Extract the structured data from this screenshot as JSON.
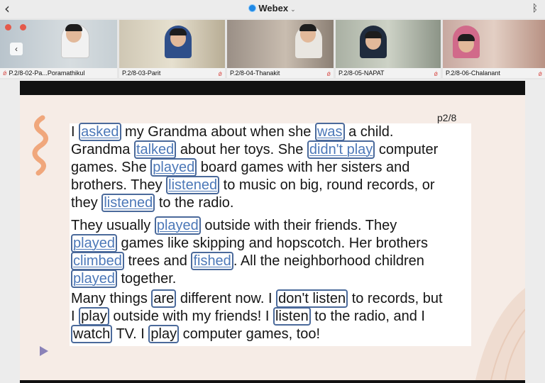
{
  "app": {
    "title": "Webex",
    "back_icon": "chevron-left-icon",
    "status_icon": "bluetooth-icon"
  },
  "participants": [
    {
      "name": "P.2/8-02-Pa...Poramathikul",
      "muted": true
    },
    {
      "name": "P.2/8-03-Parit",
      "muted": true
    },
    {
      "name": "P.2/8-04-Thanakit",
      "muted": true
    },
    {
      "name": "P.2/8-05-NAPAT",
      "muted": true
    },
    {
      "name": "P.2/8-06-Chalanant",
      "muted": true
    }
  ],
  "slide": {
    "page": "p2/8",
    "paragraphs": [
      [
        [
          {
            "t": "I "
          },
          {
            "v": "asked",
            "u": true
          },
          {
            "t": " my Grandma about when she "
          },
          {
            "v": "was",
            "u": true
          },
          {
            "t": " a child."
          }
        ],
        [
          {
            "t": "Grandma "
          },
          {
            "v": "talked",
            "u": true
          },
          {
            "t": " about her toys. She "
          },
          {
            "v": "didn't play",
            "u": true
          },
          {
            "t": " computer"
          }
        ],
        [
          {
            "t": "games. She "
          },
          {
            "v": "played",
            "u": true
          },
          {
            "t": " board games with her sisters and"
          }
        ],
        [
          {
            "t": "brothers. They "
          },
          {
            "v": "listened",
            "u": true
          },
          {
            "t": " to music on big, round records, or"
          }
        ],
        [
          {
            "t": "they "
          },
          {
            "v": "listened",
            "u": true
          },
          {
            "t": " to the radio."
          }
        ]
      ],
      [
        [
          {
            "t": "They usually "
          },
          {
            "v": "played",
            "u": true
          },
          {
            "t": " outside with their friends. They"
          }
        ],
        [
          {
            "v": "played",
            "u": true
          },
          {
            "t": " games like skipping and hopscotch. Her brothers"
          }
        ],
        [
          {
            "v": "climbed",
            "u": true
          },
          {
            "t": " trees and "
          },
          {
            "v": "fished",
            "u": true
          },
          {
            "t": ". All the neighborhood children"
          }
        ],
        [
          {
            "v": "played",
            "u": true
          },
          {
            "t": " together."
          }
        ]
      ],
      [
        [
          {
            "t": "Many things "
          },
          {
            "v": "are",
            "u": false
          },
          {
            "t": " different now. I "
          },
          {
            "v": "don't listen",
            "u": false
          },
          {
            "t": " to records, but"
          }
        ],
        [
          {
            "t": "I "
          },
          {
            "v": "play",
            "u": false
          },
          {
            "t": " outside with my friends! I "
          },
          {
            "v": "listen",
            "u": false
          },
          {
            "t": " to the radio, and I"
          }
        ],
        [
          {
            "v": "watch",
            "u": false
          },
          {
            "t": " TV. I "
          },
          {
            "v": "play",
            "u": false
          },
          {
            "t": " computer games, too!"
          }
        ]
      ]
    ]
  },
  "colors": {
    "highlight_border": "#4b6a9b",
    "past_verb": "#4c78b8",
    "slide_bg": "#f6ece6",
    "wave": "#f0a77c"
  }
}
